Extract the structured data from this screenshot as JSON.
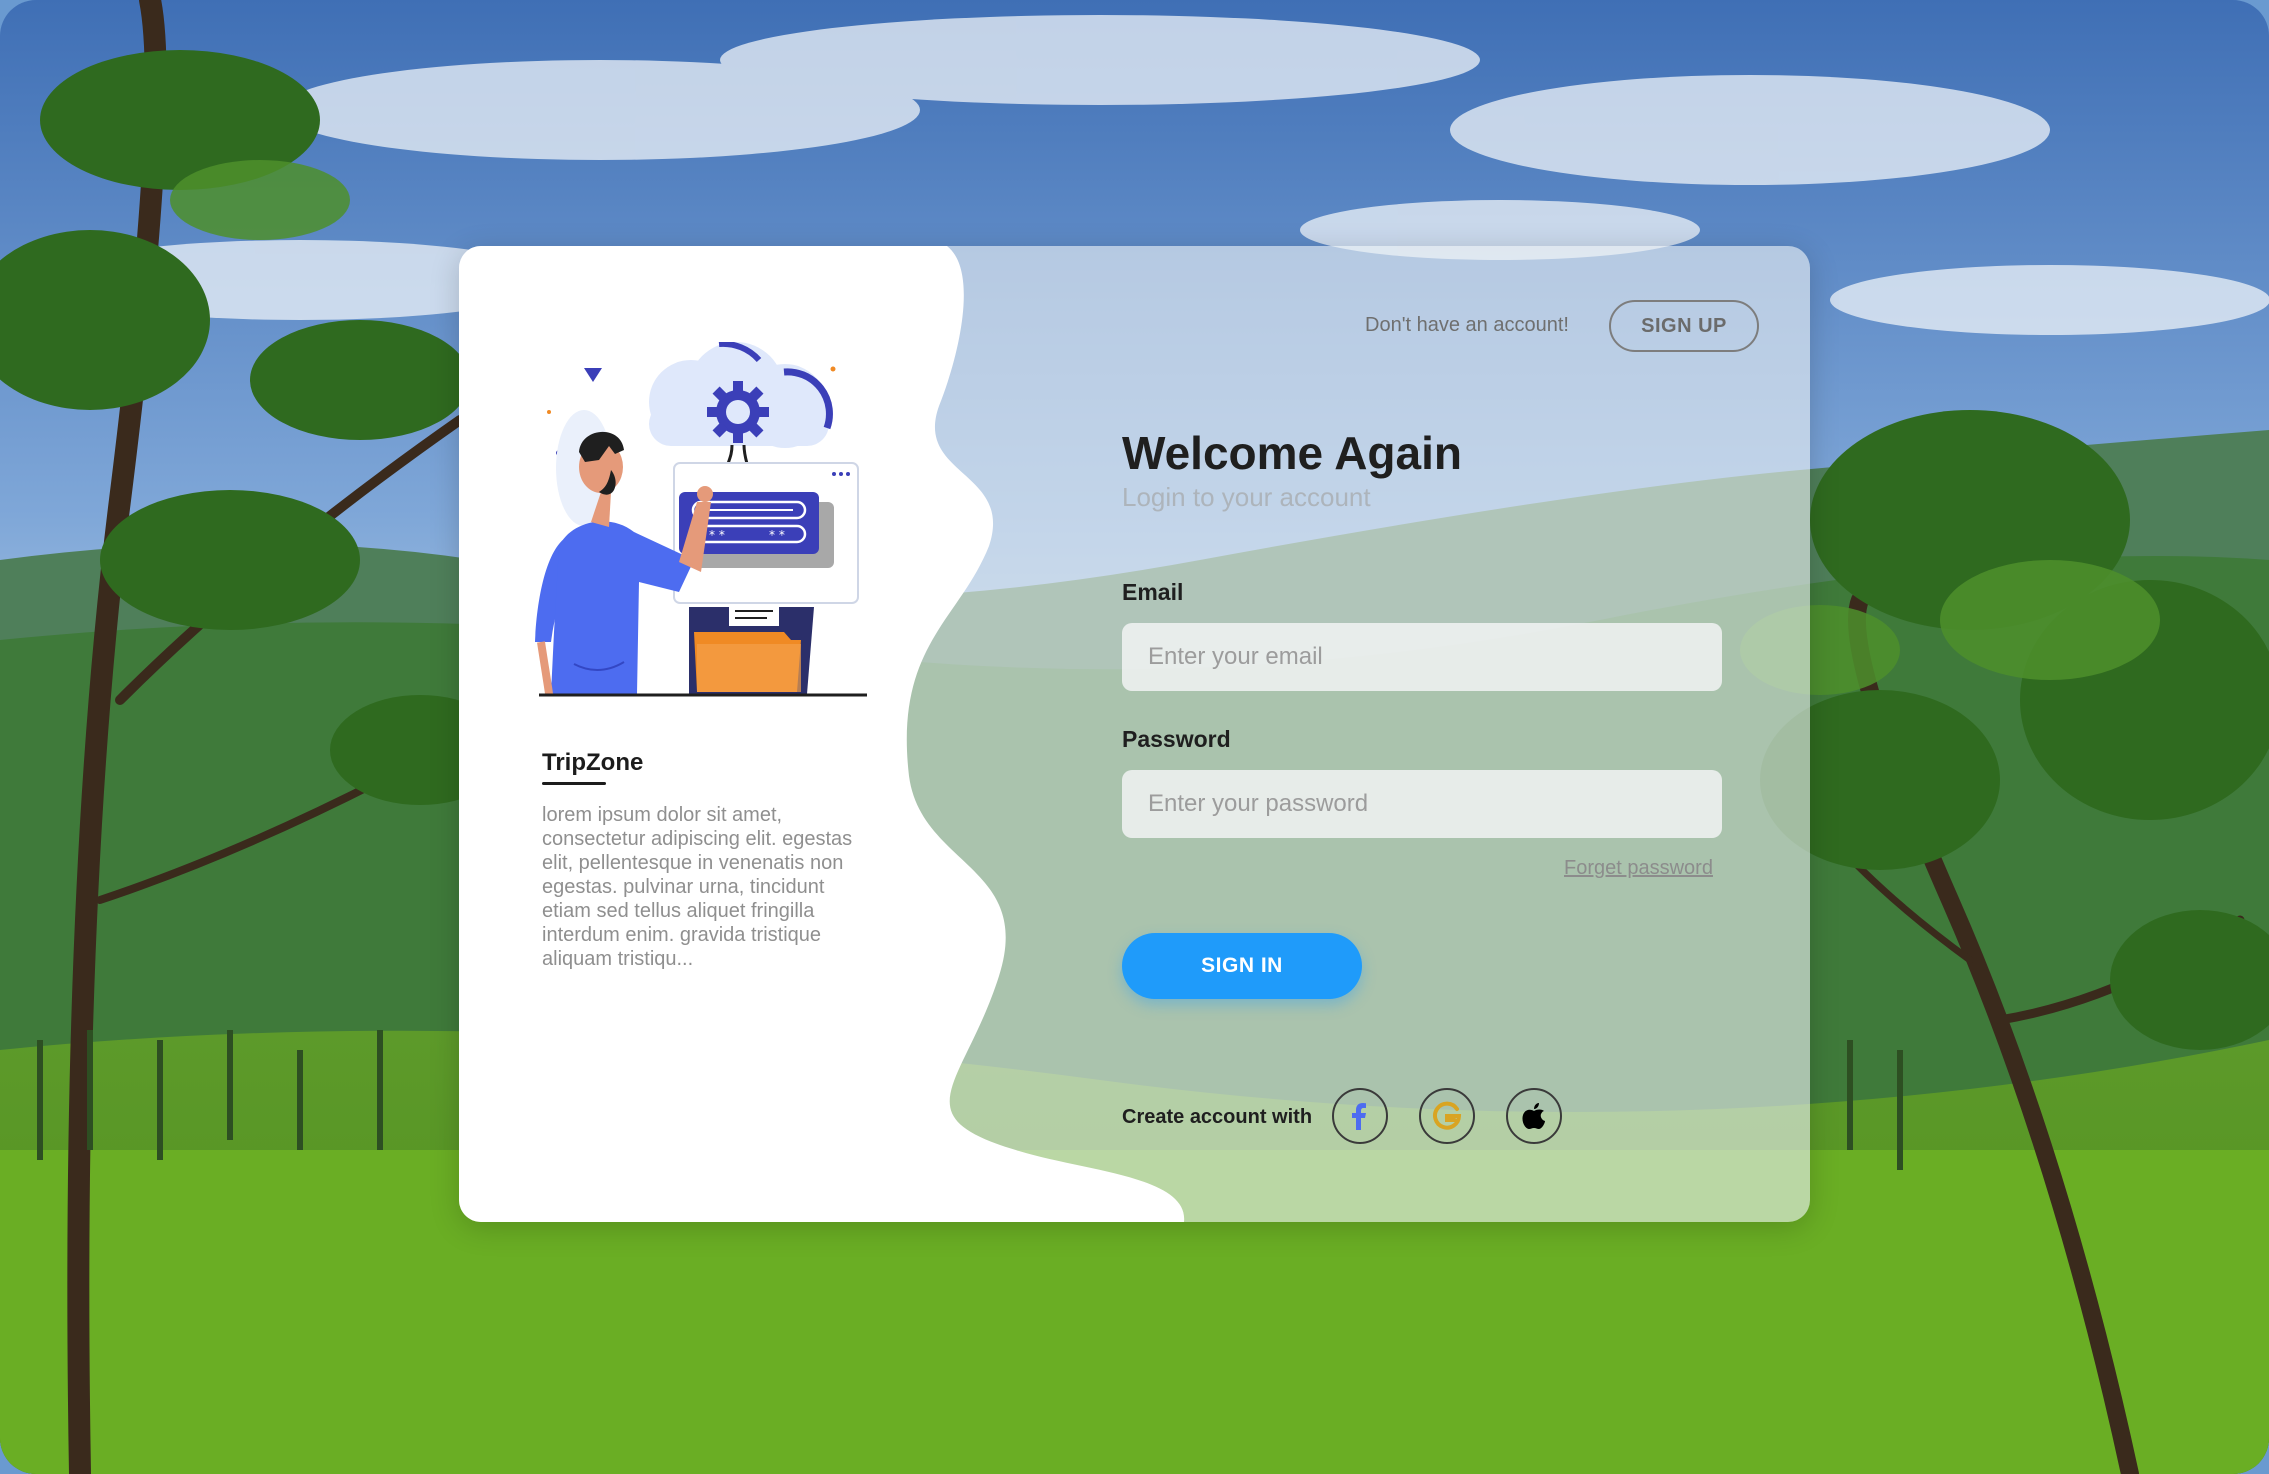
{
  "header": {
    "no_account_text": "Don't have  an account!",
    "signup_label": "SIGN UP"
  },
  "brand": {
    "name": "TripZone",
    "description": "lorem ipsum dolor sit amet, consectetur adipiscing elit. egestas elit, pellentesque in venenatis non egestas. pulvinar urna, tincidunt etiam sed tellus aliquet fringilla interdum enim. gravida tristique aliquam tristiqu..."
  },
  "form": {
    "title": "Welcome Again",
    "subtitle": "Login to your account",
    "email_label": "Email",
    "email_placeholder": "Enter your email",
    "password_label": "Password",
    "password_placeholder": "Enter your password",
    "forget_label": "Forget password",
    "signin_label": "SIGN IN"
  },
  "social": {
    "label": "Create account with",
    "providers": [
      {
        "name": "Facebook",
        "icon": "facebook-icon",
        "color": "#4d6cf0"
      },
      {
        "name": "Google",
        "icon": "google-icon",
        "color": "#d9a422"
      },
      {
        "name": "Apple",
        "icon": "apple-icon",
        "color": "#000000"
      }
    ]
  },
  "colors": {
    "accent": "#1f9bfa",
    "illustration_primary": "#3b3fb8",
    "illustration_folder": "#f08a24"
  }
}
